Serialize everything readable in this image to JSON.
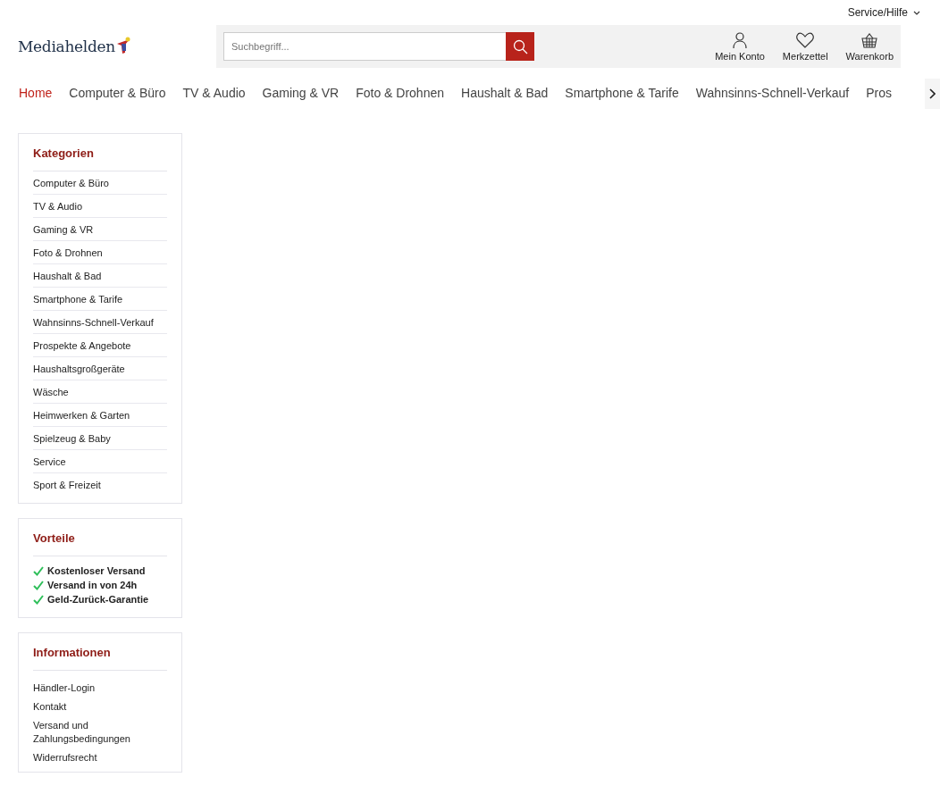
{
  "top_bar": {
    "service_menu": "Service/Hilfe"
  },
  "header": {
    "logo": "Mediahelden",
    "search": {
      "placeholder": "Suchbegriff..."
    },
    "actions": [
      {
        "kind": "account",
        "label": "Mein Konto"
      },
      {
        "kind": "wishlist",
        "label": "Merkzettel"
      },
      {
        "kind": "cart",
        "label": "Warenkorb"
      }
    ]
  },
  "nav": [
    {
      "label": "Home",
      "selected": true
    },
    {
      "label": "Computer & Büro",
      "selected": false
    },
    {
      "label": "TV & Audio",
      "selected": false
    },
    {
      "label": "Gaming & VR",
      "selected": false
    },
    {
      "label": "Foto & Drohnen",
      "selected": false
    },
    {
      "label": "Haushalt & Bad",
      "selected": false
    },
    {
      "label": "Smartphone & Tarife",
      "selected": false
    },
    {
      "label": "Wahnsinns-Schnell-Verkauf",
      "selected": false
    },
    {
      "label": "Pros",
      "selected": false
    }
  ],
  "sidebar": {
    "categories": {
      "title": "Kategorien",
      "items": [
        "Computer & Büro",
        "TV & Audio",
        "Gaming & VR",
        "Foto & Drohnen",
        "Haushalt & Bad",
        "Smartphone & Tarife",
        "Wahnsinns-Schnell-Verkauf",
        "Prospekte & Angebote",
        "Haushaltsgroßgeräte",
        "Wäsche",
        "Heimwerken & Garten",
        "Spielzeug & Baby",
        "Service",
        "Sport & Freizeit"
      ]
    },
    "benefits": {
      "title": "Vorteile",
      "items": [
        "Kostenloser Versand",
        "Versand in von 24h",
        "Geld-Zurück-Garantie"
      ]
    },
    "information": {
      "title": "Informationen",
      "items": [
        "Händler-Login",
        "Kontakt",
        "Versand und Zahlungsbedingungen",
        "Widerrufsrecht"
      ]
    }
  }
}
